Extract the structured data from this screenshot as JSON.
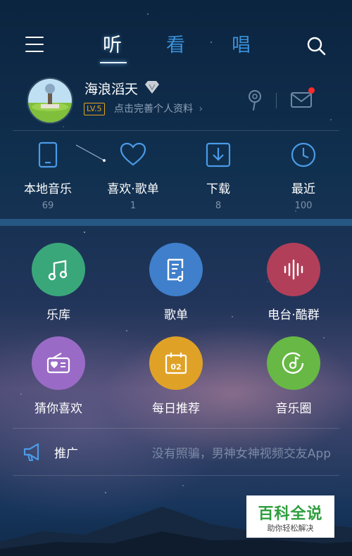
{
  "header": {
    "tabs": [
      {
        "label": "听",
        "active": true
      },
      {
        "label": "看",
        "active": false
      },
      {
        "label": "唱",
        "active": false
      }
    ],
    "menu_icon": "hamburger-menu-icon",
    "search_icon": "search-icon"
  },
  "profile": {
    "username": "海浪滔天",
    "vip_icon": "diamond-vip-icon",
    "level": "LV.5",
    "prompt": "点击完善个人资料",
    "prompt_arrow": "›",
    "has_unread_message": true
  },
  "quick_access": [
    {
      "label": "本地音乐",
      "count": "69",
      "icon": "phone-icon"
    },
    {
      "label": "喜欢·歌单",
      "count": "1",
      "icon": "heart-icon"
    },
    {
      "label": "下载",
      "count": "8",
      "icon": "download-icon"
    },
    {
      "label": "最近",
      "count": "100",
      "icon": "clock-icon"
    }
  ],
  "features": [
    {
      "label": "乐库",
      "icon": "music-note-icon",
      "color": "#3aa77a"
    },
    {
      "label": "歌单",
      "icon": "playlist-icon",
      "color": "#3f7fcc"
    },
    {
      "label": "电台·酷群",
      "icon": "soundwave-icon",
      "color": "#b23f5a"
    },
    {
      "label": "猜你喜欢",
      "icon": "radio-heart-icon",
      "color": "#9a6bc6"
    },
    {
      "label": "每日推荐",
      "icon": "calendar-icon",
      "color": "#e0a226",
      "calendar_day": "02"
    },
    {
      "label": "音乐圈",
      "icon": "music-circle-icon",
      "color": "#67b845"
    }
  ],
  "promo": {
    "label": "推广",
    "text": "没有照骗，男神女神视频交友App",
    "icon": "megaphone-icon"
  },
  "watermark": {
    "title": "百科全说",
    "subtitle": "助你轻松解决"
  }
}
